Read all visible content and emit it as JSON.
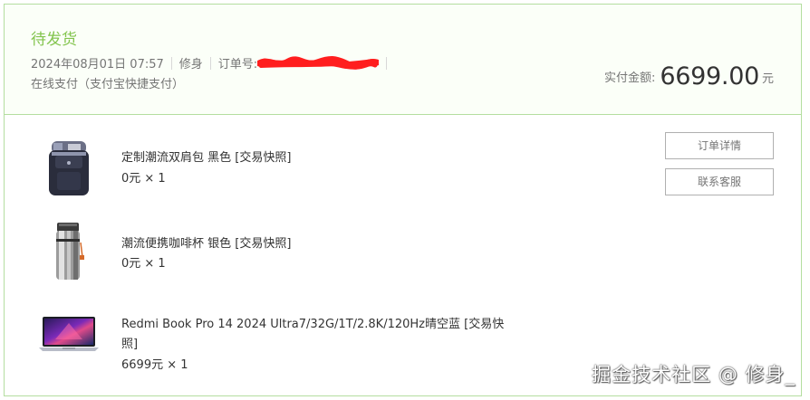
{
  "order": {
    "status": "待发货",
    "datetime": "2024年08月01日 07:57",
    "user": "修身",
    "order_no_label": "订单号:",
    "payment": "在线支付（支付宝快捷支付）",
    "total_label": "实付金额:",
    "total_amount": "6699.00",
    "total_unit": "元"
  },
  "items": [
    {
      "name": "定制潮流双肩包 黑色",
      "snapshot_label": "[交易快照]",
      "price_qty": "0元 × 1",
      "thumb_icon": "backpack-icon"
    },
    {
      "name": "潮流便携咖啡杯 银色",
      "snapshot_label": "[交易快照]",
      "price_qty": "0元 × 1",
      "thumb_icon": "coffee-tumbler-icon"
    },
    {
      "name": "Redmi Book Pro 14 2024 Ultra7/32G/1T/2.8K/120Hz晴空蓝",
      "snapshot_label": "[交易快照]",
      "price_qty": "6699元 × 1",
      "thumb_icon": "laptop-icon"
    }
  ],
  "actions": {
    "details_label": "订单详情",
    "support_label": "联系客服"
  },
  "watermark": "掘金技术社区 @ 修身_",
  "colors": {
    "status_green": "#83c44e",
    "border_green": "#b4dea0",
    "redaction_red": "#ff1e1e"
  }
}
